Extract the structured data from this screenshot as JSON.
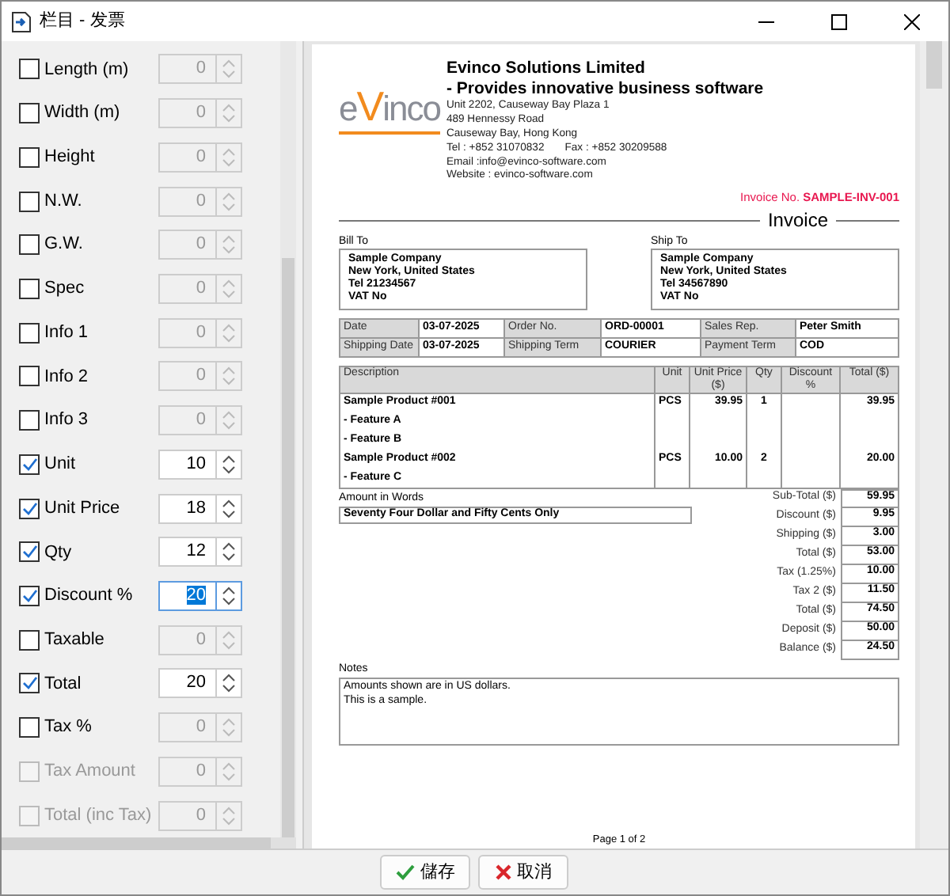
{
  "window": {
    "title": "栏目 - 发票"
  },
  "fields": [
    {
      "label": "Length (m)",
      "checked": false,
      "disabled": false,
      "value": "0",
      "focused": false
    },
    {
      "label": "Width (m)",
      "checked": false,
      "disabled": false,
      "value": "0",
      "focused": false
    },
    {
      "label": "Height",
      "checked": false,
      "disabled": false,
      "value": "0",
      "focused": false
    },
    {
      "label": "N.W.",
      "checked": false,
      "disabled": false,
      "value": "0",
      "focused": false
    },
    {
      "label": "G.W.",
      "checked": false,
      "disabled": false,
      "value": "0",
      "focused": false
    },
    {
      "label": "Spec",
      "checked": false,
      "disabled": false,
      "value": "0",
      "focused": false
    },
    {
      "label": "Info 1",
      "checked": false,
      "disabled": false,
      "value": "0",
      "focused": false
    },
    {
      "label": "Info 2",
      "checked": false,
      "disabled": false,
      "value": "0",
      "focused": false
    },
    {
      "label": "Info 3",
      "checked": false,
      "disabled": false,
      "value": "0",
      "focused": false
    },
    {
      "label": "Unit",
      "checked": true,
      "disabled": false,
      "value": "10",
      "focused": false
    },
    {
      "label": "Unit Price",
      "checked": true,
      "disabled": false,
      "value": "18",
      "focused": false
    },
    {
      "label": "Qty",
      "checked": true,
      "disabled": false,
      "value": "12",
      "focused": false
    },
    {
      "label": "Discount %",
      "checked": true,
      "disabled": false,
      "value": "20",
      "focused": true
    },
    {
      "label": "Taxable",
      "checked": false,
      "disabled": false,
      "value": "0",
      "focused": false
    },
    {
      "label": "Total",
      "checked": true,
      "disabled": false,
      "value": "20",
      "focused": false
    },
    {
      "label": "Tax %",
      "checked": false,
      "disabled": false,
      "value": "0",
      "focused": false
    },
    {
      "label": "Tax Amount",
      "checked": false,
      "disabled": true,
      "value": "0",
      "focused": false
    },
    {
      "label": "Total (inc Tax)",
      "checked": false,
      "disabled": true,
      "value": "0",
      "focused": false
    }
  ],
  "invoice": {
    "logo_text": "eVinco",
    "company_name": "Evinco Solutions Limited",
    "tagline": "- Provides innovative business software",
    "address_lines": [
      "Unit 2202, Causeway Bay Plaza 1",
      "489 Hennessy Road",
      "Causeway Bay, Hong Kong"
    ],
    "tel": "Tel : +852 31070832",
    "fax": "Fax : +852 30209588",
    "contact_lines": [
      "Email :info@evinco-software.com",
      "Website : evinco-software.com"
    ],
    "invoice_no_label": "Invoice No.",
    "invoice_no": "SAMPLE-INV-001",
    "heading": "Invoice",
    "bill_to": {
      "label": "Bill To",
      "lines": [
        "Sample Company",
        "New York, United States",
        "Tel 21234567",
        "VAT No"
      ]
    },
    "ship_to": {
      "label": "Ship To",
      "lines": [
        "Sample Company",
        "New York, United States",
        "Tel 34567890",
        "VAT No"
      ]
    },
    "info_rows": [
      [
        {
          "label": "Date",
          "value": "03-07-2025"
        },
        {
          "label": "Order No.",
          "value": "ORD-00001"
        },
        {
          "label": "Sales Rep.",
          "value": "Peter Smith"
        }
      ],
      [
        {
          "label": "Shipping Date",
          "value": "03-07-2025"
        },
        {
          "label": "Shipping Term",
          "value": "COURIER"
        },
        {
          "label": "Payment Term",
          "value": "COD"
        }
      ]
    ],
    "columns": [
      "Description",
      "Unit",
      "Unit Price ($)",
      "Qty",
      "Discount %",
      "Total ($)"
    ],
    "rows": [
      {
        "cells": [
          "Sample Product #001",
          "PCS",
          "39.95",
          "1",
          "",
          "39.95"
        ]
      },
      {
        "cells": [
          "- Feature A"
        ]
      },
      {
        "cells": [
          "- Feature B"
        ]
      },
      {
        "cells": [
          "Sample Product #002",
          "PCS",
          "10.00",
          "2",
          "",
          "20.00"
        ]
      },
      {
        "cells": [
          "- Feature C"
        ]
      }
    ],
    "amount_in_words": {
      "label": "Amount in Words",
      "value": "Seventy Four Dollar and Fifty Cents Only"
    },
    "totals": [
      {
        "label": "Sub-Total ($)",
        "value": "59.95"
      },
      {
        "label": "Discount ($)",
        "value": "9.95"
      },
      {
        "label": "Shipping ($)",
        "value": "3.00"
      },
      {
        "label": "Total ($)",
        "value": "53.00"
      },
      {
        "label": "Tax (1.25%)",
        "value": "10.00"
      },
      {
        "label": "Tax 2 ($)",
        "value": "11.50"
      },
      {
        "label": "Total ($)",
        "value": "74.50"
      },
      {
        "label": "Deposit ($)",
        "value": "50.00"
      },
      {
        "label": "Balance ($)",
        "value": "24.50"
      }
    ],
    "notes": {
      "label": "Notes",
      "lines": [
        "Amounts shown are in US dollars.",
        "This is a sample."
      ]
    },
    "page_footer": "Page 1 of 2"
  },
  "buttons": [
    {
      "kind": "save",
      "label": "儲存"
    },
    {
      "kind": "cancel",
      "label": "取消"
    }
  ]
}
